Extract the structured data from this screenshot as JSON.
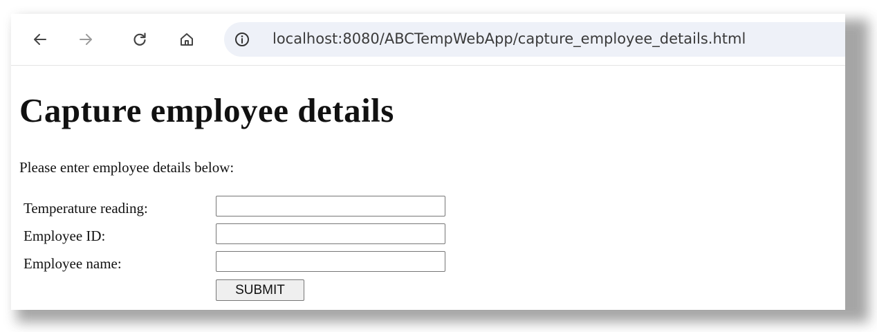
{
  "browser": {
    "url": "localhost:8080/ABCTempWebApp/capture_employee_details.html",
    "icons": {
      "back": "arrow-left-icon",
      "forward": "arrow-right-icon",
      "reload": "reload-icon",
      "home": "home-icon",
      "site_info": "info-icon"
    }
  },
  "page": {
    "title": "Capture employee details",
    "instructions": "Please enter employee details below:"
  },
  "form": {
    "temperature_label": "Temperature reading:",
    "temperature_value": "",
    "employee_id_label": "Employee ID:",
    "employee_id_value": "",
    "employee_name_label": "Employee name:",
    "employee_name_value": "",
    "submit_label": "SUBMIT"
  },
  "colors": {
    "address_bar": "#eef1f8",
    "text": "#111111",
    "button_bg": "#efefef"
  }
}
